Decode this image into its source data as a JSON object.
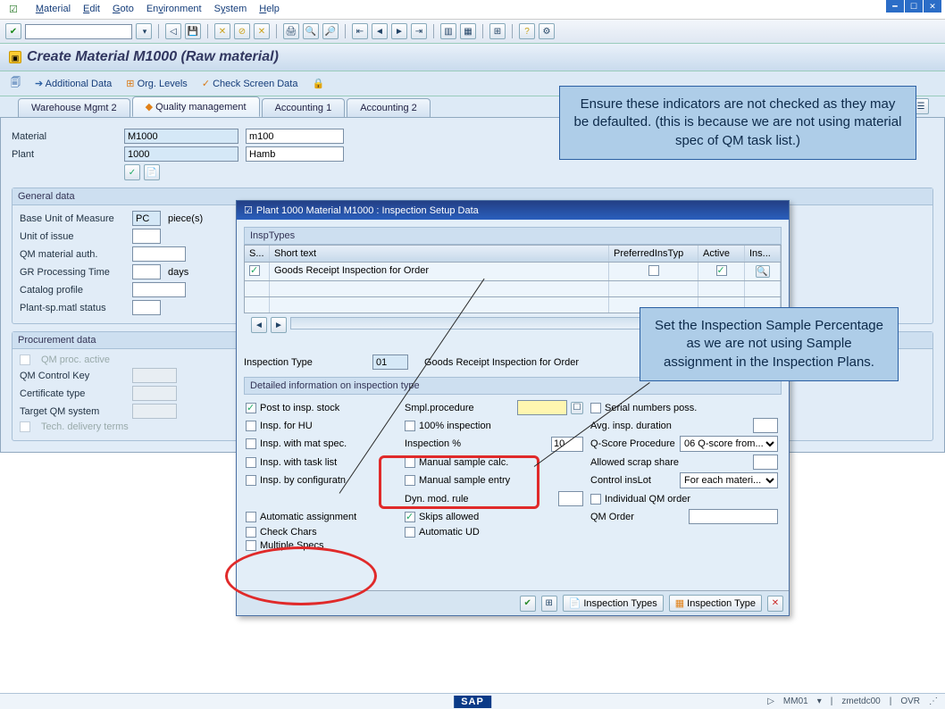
{
  "menu": {
    "items": [
      "Material",
      "Edit",
      "Goto",
      "Environment",
      "System",
      "Help"
    ]
  },
  "page_title": "Create Material M1000 (Raw material)",
  "sub_toolbar": {
    "additional": "Additional Data",
    "org": "Org. Levels",
    "check": "Check Screen Data"
  },
  "tabs": [
    "Warehouse Mgmt 2",
    "Quality management",
    "Accounting 1",
    "Accounting 2"
  ],
  "main": {
    "material_label": "Material",
    "material_value": "M1000",
    "material_desc": "m100",
    "plant_label": "Plant",
    "plant_value": "1000",
    "plant_desc": "Hamb"
  },
  "general": {
    "title": "General data",
    "labels": {
      "buom": "Base Unit of Measure",
      "buom_val": "PC",
      "buom_suffix": "piece(s)",
      "uoi": "Unit of issue",
      "qmauth": "QM material auth.",
      "grtime": "GR Processing Time",
      "grtime_suffix": "days",
      "catalog": "Catalog profile",
      "plantstat": "Plant-sp.matl status"
    }
  },
  "proc": {
    "title": "Procurement data",
    "labels": {
      "qmproc": "QM proc. active",
      "qmctrl": "QM Control Key",
      "cert": "Certificate type",
      "target": "Target QM system",
      "tech": "Tech. delivery terms"
    }
  },
  "dialog": {
    "title": "Plant 1000 Material M1000 : Inspection Setup Data",
    "grid_title": "InspTypes",
    "cols": {
      "s": "S...",
      "short": "Short text",
      "pref": "PreferredInsTyp",
      "active": "Active",
      "ins": "Ins..."
    },
    "row1": {
      "short": "Goods Receipt Inspection for Order"
    },
    "insp_type_label": "Inspection Type",
    "insp_type_val": "01",
    "insp_type_desc": "Goods Receipt Inspection for Order",
    "detail_title": "Detailed information on inspection type",
    "col1": {
      "post": "Post to insp. stock",
      "hu": "Insp. for HU",
      "matspec": "Insp. with mat spec.",
      "tasklist": "Insp. with task list",
      "configuratn": "Insp. by configuratn",
      "auto": "Automatic assignment",
      "checkchars": "Check Chars",
      "multspecs": "Multiple Specs"
    },
    "col2": {
      "smpl": "Smpl.procedure",
      "hundred": "100% inspection",
      "inspct": "Inspection %",
      "inspct_val": "10",
      "mansc": "Manual sample calc.",
      "manse": "Manual sample entry",
      "dyn": "Dyn. mod. rule",
      "skips": "Skips allowed",
      "autoud": "Automatic UD"
    },
    "col3": {
      "serial": "Serial numbers poss.",
      "avg": "Avg. insp. duration",
      "qscore": "Q-Score Procedure",
      "qscore_val": "06 Q-score from...",
      "scrap": "Allowed scrap share",
      "ctrl": "Control insLot",
      "ctrl_val": "For each materi...",
      "indiv": "Individual QM order",
      "qmorder": "QM Order"
    },
    "footer": {
      "insptypes": "Inspection Types",
      "insptype": "Inspection Type"
    }
  },
  "callouts": {
    "top": "Ensure these indicators are not checked as they may be defaulted. (this is because we are not using material spec of QM task list.)",
    "bottom": "Set the Inspection Sample Percentage as we are not using Sample assignment in the Inspection Plans."
  },
  "statusbar": {
    "tcode": "MM01",
    "sys": "zmetdc00",
    "mode": "OVR"
  }
}
